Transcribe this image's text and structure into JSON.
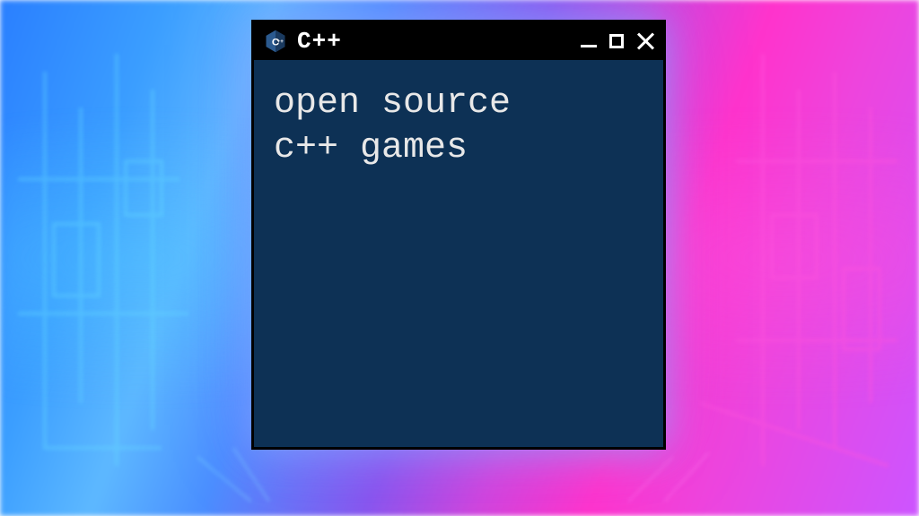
{
  "window": {
    "title": "C++",
    "body_text": "open source\nc++ games"
  },
  "colors": {
    "window_bg": "#0d3155",
    "titlebar_bg": "#000000",
    "text": "#e8e8e8"
  }
}
